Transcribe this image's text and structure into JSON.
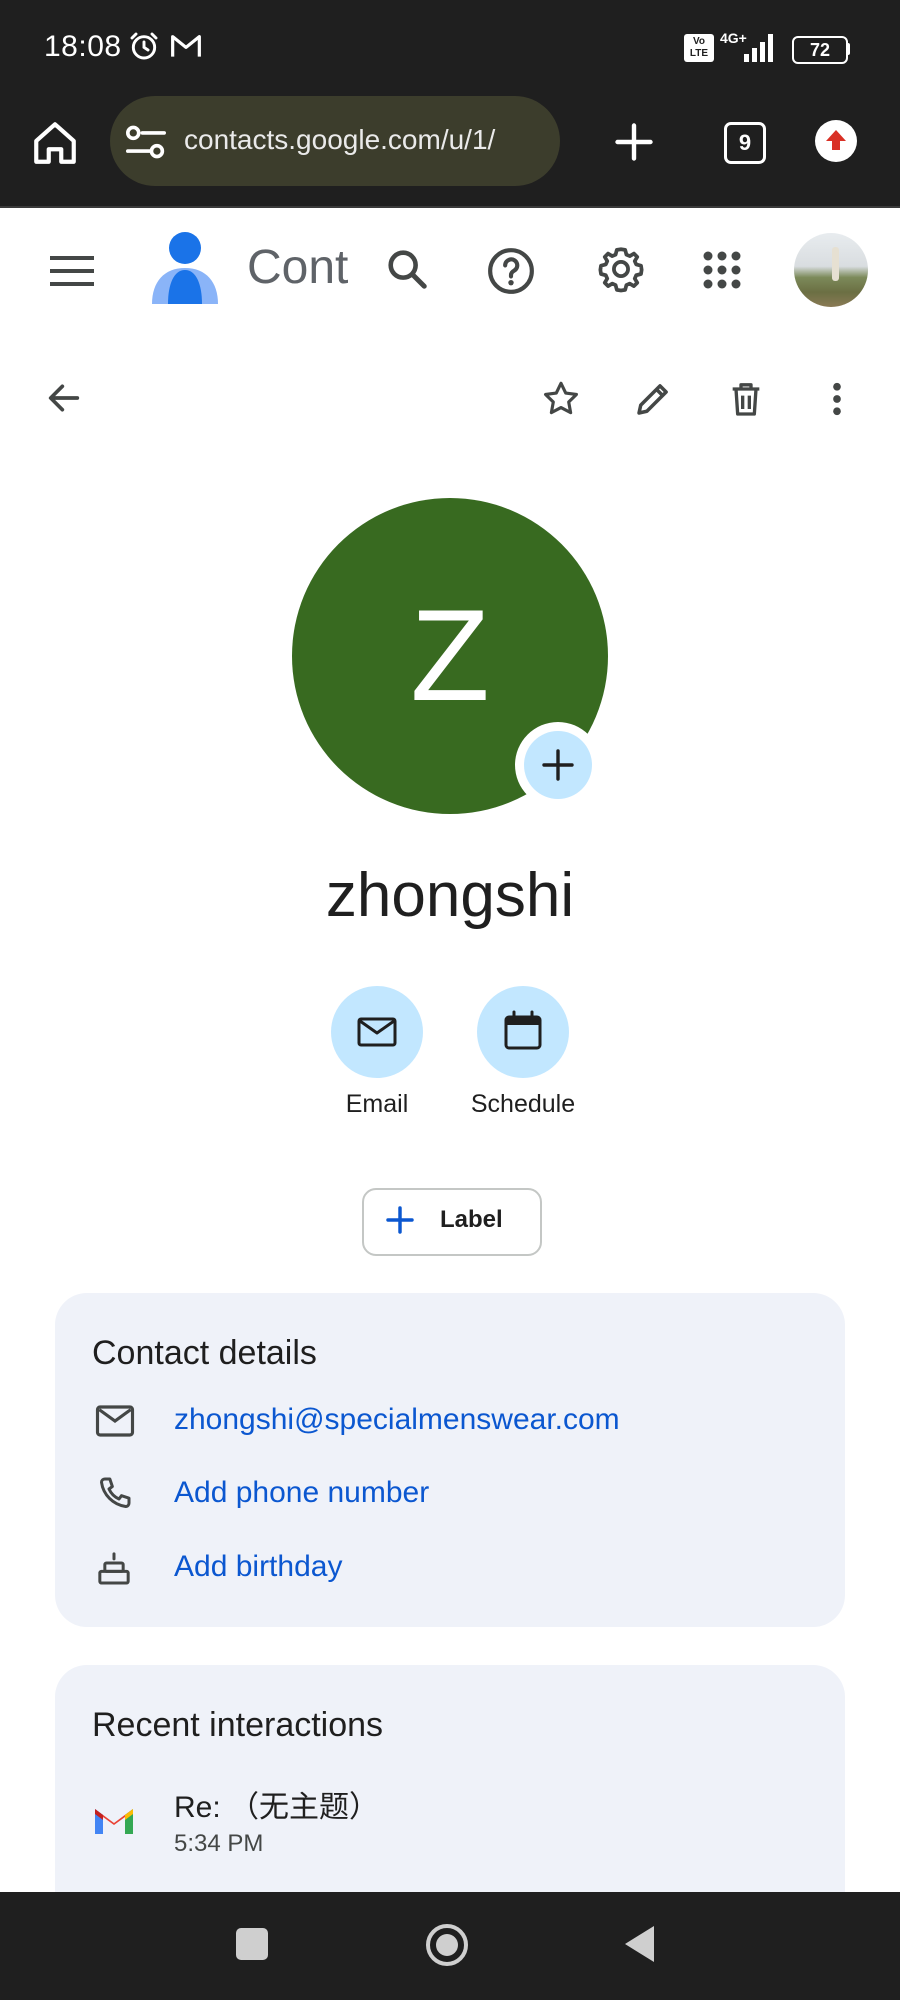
{
  "status_bar": {
    "time": "18:08",
    "network": "4G+",
    "volte": "Vo LTE",
    "battery": "72",
    "icons": [
      "alarm-icon",
      "gmail-notification-icon",
      "volte-icon",
      "signal-icon",
      "battery-icon"
    ]
  },
  "browser": {
    "url": "contacts.google.com/u/1/",
    "tab_count": "9",
    "icons": [
      "home-icon",
      "site-settings-icon",
      "new-tab-icon",
      "tabs-icon",
      "update-icon"
    ]
  },
  "app_bar": {
    "title": "Cont",
    "icons": [
      "menu-icon",
      "contacts-logo-icon",
      "search-icon",
      "help-icon",
      "settings-icon",
      "apps-icon",
      "account-avatar"
    ]
  },
  "toolbar": {
    "icons": [
      "back-arrow-icon",
      "star-icon",
      "edit-icon",
      "delete-icon",
      "more-vert-icon"
    ]
  },
  "contact": {
    "initial": "Z",
    "name": "zhongshi",
    "avatar_color": "#386a20"
  },
  "actions": [
    {
      "label": "Email",
      "icon": "mail-icon"
    },
    {
      "label": "Schedule",
      "icon": "calendar-icon"
    }
  ],
  "label_button": {
    "text": "Label",
    "icon": "plus-icon"
  },
  "contact_details": {
    "title": "Contact details",
    "email": "zhongshi@specialmenswear.com",
    "add_phone": "Add phone number",
    "add_birthday": "Add birthday"
  },
  "recent_interactions": {
    "title": "Recent interactions",
    "items": [
      {
        "subject": "Re: （无主题）",
        "time": "5:34 PM",
        "icon": "gmail-icon"
      }
    ]
  },
  "colors": {
    "accent_link": "#0b57d0",
    "chip_blue": "#c2e7ff",
    "card_bg": "#eff2f9"
  }
}
